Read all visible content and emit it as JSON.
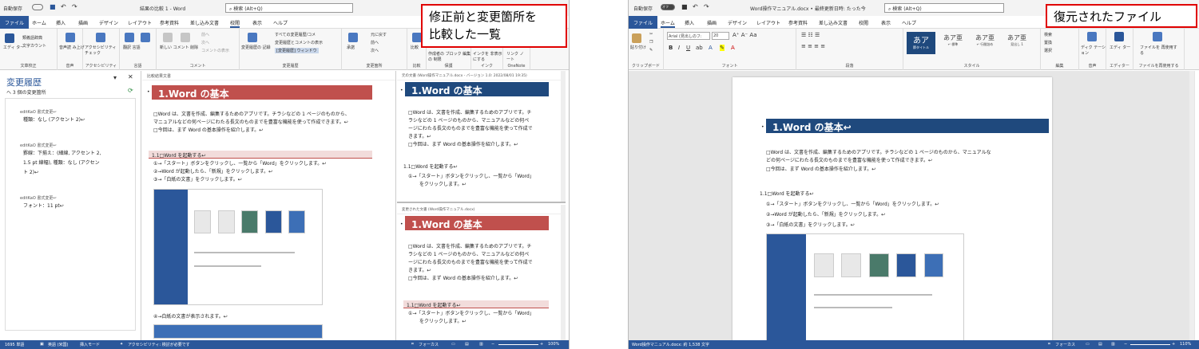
{
  "compare": {
    "autosave": "自動保存",
    "title": "結果の比較 1  -  Word",
    "search": "検索 (Alt+Q)",
    "tabs": [
      "ファイル",
      "ホーム",
      "挿入",
      "描画",
      "デザイン",
      "レイアウト",
      "参考資料",
      "差し込み文書",
      "校閲",
      "表示",
      "ヘルプ"
    ],
    "groups": [
      {
        "label": "文章校正",
        "items": [
          "類義語辞典",
          "文字カウント"
        ],
        "big": "エディ ター"
      },
      {
        "label": "音声",
        "items": [],
        "big": "音声読 み上げ"
      },
      {
        "label": "アクセシビリティ",
        "items": [],
        "big": "アクセシビリティ チェック"
      },
      {
        "label": "言語",
        "items": [],
        "big": "翻訳  言語"
      },
      {
        "label": "コメント",
        "items": [
          "前へ",
          "次へ",
          "コメントの表示"
        ],
        "big": "新しい コメント  削除"
      },
      {
        "label": "変更履歴",
        "items": [
          "すべての変更履歴/コメ",
          "変更履歴とコメントの表示",
          "[変更履歴] ウィンドウ"
        ],
        "big": "変更履歴の 記録"
      },
      {
        "label": "変更箇所",
        "items": [
          "元に戻す",
          "前へ",
          "次へ"
        ],
        "big": "承諾"
      },
      {
        "label": "比較",
        "items": [],
        "big": "比較"
      },
      {
        "label": "保護",
        "items": [],
        "big": "作成者の ブロック  編集の 制限"
      },
      {
        "label": "インク",
        "items": [],
        "big": "インクを 非表示にする"
      },
      {
        "label": "OneNote",
        "items": [],
        "big": "リンク ノート"
      }
    ],
    "callout": [
      "修正前と変更箇所を",
      "比較した一覧"
    ],
    "revpane": {
      "title": "変更履歴",
      "count": "3 個の変更箇所",
      "entries": [
        {
          "author": "editKaO 書式変更↩",
          "lines": [
            "種類：なし (アクセント 2)↩"
          ]
        },
        {
          "author": "editKaO 書式変更↩",
          "lines": [
            "罫線：下揃え：(細線, アクセント 2,",
            "1.5 pt 線幅), 種類：なし (アクセン",
            "ト 2)↩"
          ]
        },
        {
          "author": "editKaO 書式変更↩",
          "lines": [
            "フォント：11 pt↩"
          ]
        }
      ]
    },
    "doc": {
      "header": "比較結果文書",
      "heading": "1.Word の基本",
      "para": [
        "□Word は、文書を作成、編集するためのアプリです。チラシなどの 1 ページのものから、",
        "マニュアルなどの何ページにわたる長文のものまでを豊富な機能を使って作成できます。↩",
        "□今回は、まず Word の基本操作を紹介します。↩"
      ],
      "sub": "1.1□Word を起動する↩",
      "steps": [
        "①→「スタート」ボタンをクリックし、一覧から「Word」をクリックします。↩",
        "②→Word が起動したら、「新規」をクリックします。↩",
        "③→「白紙の文書」をクリックします。↩"
      ],
      "step4": "④→白紙の文書が表示されます。↩"
    },
    "orig": {
      "header": "元の文書 (Word操作マニュアル.docx - バージョン 1.0: 2022/08/01 19:35)",
      "heading": "1.Word の基本",
      "para": [
        "□Word は、文書を作成、編集するためのアプリです。チ",
        "ラシなどの 1 ページのものから、マニュアルなどの何ペ",
        "ージにわたる長文のものまでを豊富な機能を使って作成で",
        "きます。↩",
        "□今回は、まず Word の基本操作を紹介します。↩"
      ],
      "sub": "1.1□Word を起動する↩",
      "steps": [
        "①→「スタート」ボタンをクリックし、一覧から「Word」",
        "をクリックします。↩"
      ]
    },
    "rev": {
      "header": "変更された文書 (Word操作マニュアル.docx)",
      "heading": "1.Word の基本",
      "para": [
        "□Word は、文書を作成、編集するためのアプリです。チ",
        "ラシなどの 1 ページのものから、マニュアルなどの何ペ",
        "ージにわたる長文のものまでを豊富な機能を使って作成で",
        "きます。↩",
        "□今回は、まず Word の基本操作を紹介します。↩"
      ],
      "sub": "1.1□Word を起動する↩",
      "steps": [
        "①→「スタート」ボタンをクリックし、一覧から「Word」",
        "をクリックします。↩"
      ]
    },
    "status": {
      "words": "1695 単語",
      "lang": "英語 (米国)",
      "mode": "挿入モード",
      "access": "アクセシビリティ: 検討が必要です",
      "focus": "フォーカス",
      "zoom": "100%"
    }
  },
  "restored": {
    "autosave": "自動保存",
    "toggle": "オフ",
    "title": "Word操作マニュアル.docx • 最終更新日時: たった今",
    "search": "検索 (Alt+Q)",
    "tabs": [
      "ファイル",
      "ホーム",
      "挿入",
      "描画",
      "デザイン",
      "レイアウト",
      "参考資料",
      "差し込み文書",
      "校閲",
      "表示",
      "ヘルプ"
    ],
    "font": "Arial (見出しのフ:",
    "size": "20",
    "styles": [
      {
        "sample": "あア",
        "name": "節タイトル"
      },
      {
        "sample": "あア亜",
        "name": "↵ 標準"
      },
      {
        "sample": "あア亜",
        "name": "↵ 行間詰め"
      },
      {
        "sample": "あア亜",
        "name": "見出し 1"
      }
    ],
    "groups": [
      "クリップボード",
      "フォント",
      "段落",
      "スタイル",
      "編集",
      "音声",
      "エディター",
      "ファイルを再使用する"
    ],
    "editItems": [
      "検索",
      "置換",
      "選択"
    ],
    "bigButtons": [
      "ディク テーション",
      "エディ ター",
      "ファイルを 再使用する"
    ],
    "paste": "貼り付け",
    "callout": "復元されたファイル",
    "doc": {
      "heading": "1.Word の基本↩",
      "para": [
        "□Word は、文書を作成、編集するためのアプリです。チラシなどの 1 ページのものから、マニュアルな",
        "どの何ページにわたる長文のものまでを豊富な機能を使って作成できます。↩",
        "□今回は、まず Word の基本操作を紹介します。↩"
      ],
      "sub": "1.1□Word を起動する↩",
      "steps": [
        "①→「スタート」ボタンをクリックし、一覧から「Word」をクリックします。↩",
        "②→Word が起動したら、「新規」をクリックします。↩",
        "③→「白紙の文書」をクリックします。↩"
      ]
    },
    "status": {
      "info": "Word操作マニュアル.docx: 約 1,538 文字",
      "focus": "フォーカス",
      "zoom": "110%"
    }
  },
  "colors": {
    "wordBlue": "#2b579a",
    "headingRed": "#c0504d",
    "headingNavy": "#1f497d",
    "callout": "#e00000"
  }
}
